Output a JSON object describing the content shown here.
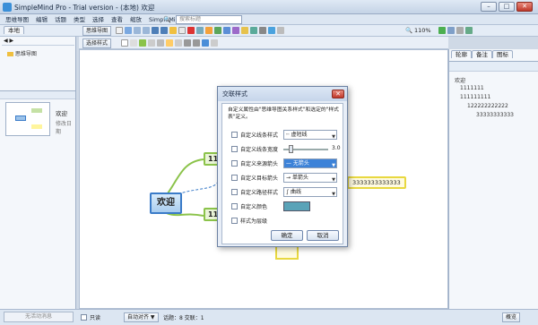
{
  "window": {
    "title": "SimpleMind Pro - Trial version - (本地) 欢迎"
  },
  "menu": [
    "思维导图",
    "编辑",
    "话题",
    "类型",
    "选择",
    "查看",
    "缩放",
    "SimpleMind"
  ],
  "search": {
    "placeholder": "搜索标题"
  },
  "toolbar": {
    "mindmap_btn": "思维导图",
    "zoom": "110%"
  },
  "toolbar2": {
    "style_btn": "选择样式"
  },
  "left_panel": {
    "tabs": [
      "本地"
    ],
    "tree_root": "思维导图",
    "preview_title": "欢迎",
    "preview_sub": "修改日期"
  },
  "canvas": {
    "central_topic": "欢迎",
    "topics": [
      "11",
      "11",
      "3333333333333"
    ]
  },
  "right_panel": {
    "tabs": [
      "轮廓",
      "备注",
      "图标"
    ],
    "outline": [
      "欢迎",
      "1111111",
      "111111111",
      "122222222222",
      "33333333333"
    ]
  },
  "dialog": {
    "title": "交联样式",
    "description": "自定义属性由\"思维导图关系样式\"和选定的\"样式表\"定义。",
    "rows": [
      {
        "label": "自定义线条样式",
        "value": "虚短线"
      },
      {
        "label": "自定义线条宽度",
        "value": "3.0"
      },
      {
        "label": "自定义来源箭头",
        "value": "无箭头"
      },
      {
        "label": "自定义目标箭头",
        "value": "单箭头"
      },
      {
        "label": "自定义路径样式",
        "value": "曲线"
      },
      {
        "label": "自定义颜色",
        "value": ""
      },
      {
        "label": "样式为层级",
        "value": ""
      }
    ],
    "ok": "确定",
    "cancel": "取消"
  },
  "status": {
    "left": "无活动消息",
    "readonly": "只读",
    "mode": "自动对齐",
    "info": "话题：8 交联：1",
    "overview": "概览"
  }
}
